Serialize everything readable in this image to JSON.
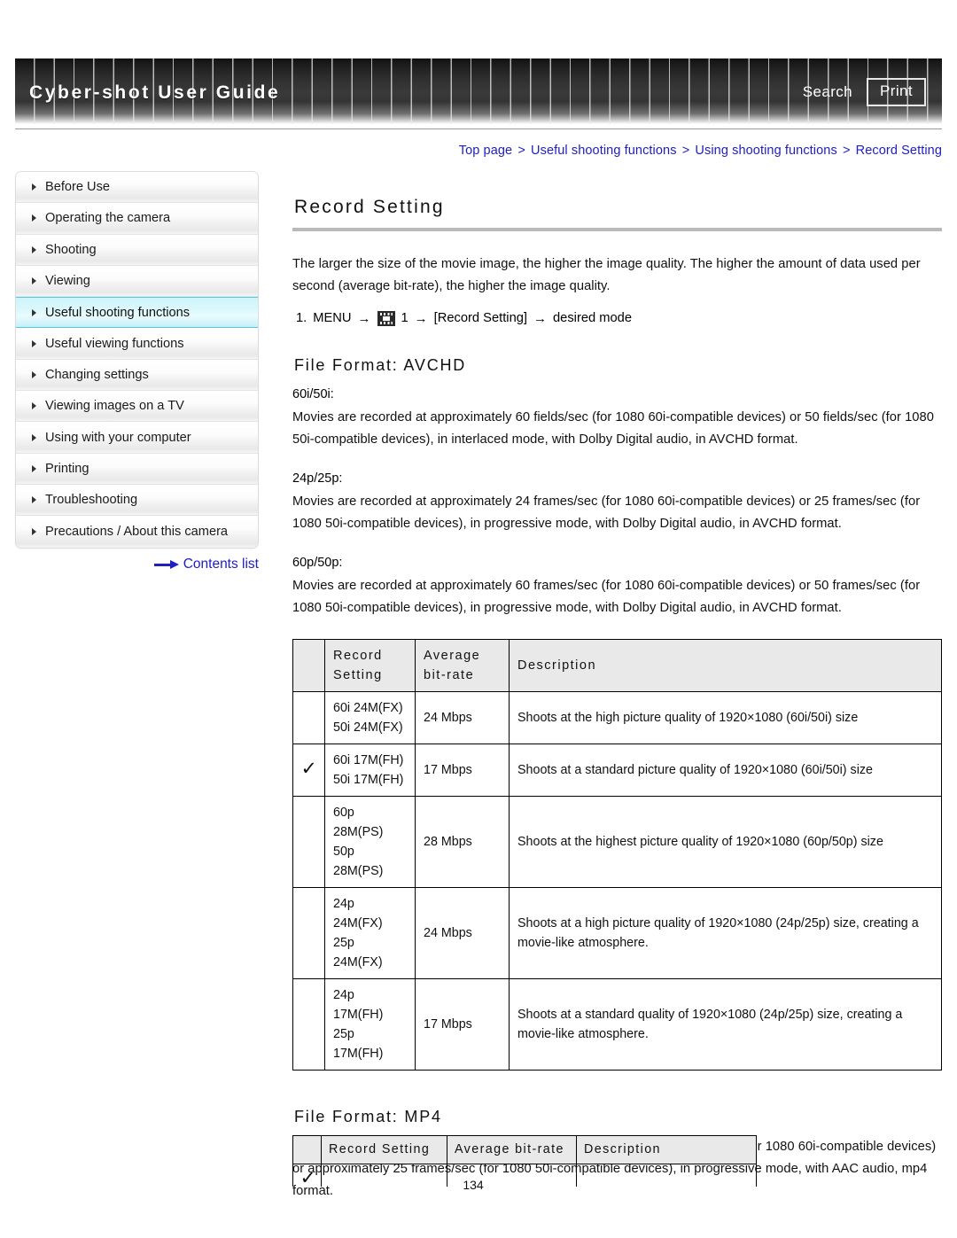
{
  "header": {
    "title": "Cyber-shot User Guide",
    "search_label": "Search",
    "print_label": "Print"
  },
  "breadcrumb": {
    "items": [
      "Top page",
      "Useful shooting functions",
      "Using shooting functions",
      "Record Setting"
    ],
    "separator": ">"
  },
  "sidebar": {
    "items": [
      {
        "label": "Before Use",
        "active": false
      },
      {
        "label": "Operating the camera",
        "active": false
      },
      {
        "label": "Shooting",
        "active": false
      },
      {
        "label": "Viewing",
        "active": false
      },
      {
        "label": "Useful shooting functions",
        "active": true
      },
      {
        "label": "Useful viewing functions",
        "active": false
      },
      {
        "label": "Changing settings",
        "active": false
      },
      {
        "label": "Viewing images on a TV",
        "active": false
      },
      {
        "label": "Using with your computer",
        "active": false
      },
      {
        "label": "Printing",
        "active": false
      },
      {
        "label": "Troubleshooting",
        "active": false
      },
      {
        "label": "Precautions / About this camera",
        "active": false
      }
    ],
    "contents_link": "Contents list"
  },
  "main": {
    "page_title": "Record Setting",
    "intro": "The larger the size of the movie image, the higher the image quality. The higher the amount of data used per second (average bit-rate), the higher the image quality.",
    "step": {
      "number": "1.",
      "menu": "MENU",
      "arrow": "→",
      "icon_suffix": "1",
      "bracket": "[Record Setting]",
      "tail": "desired mode"
    },
    "avchd": {
      "heading": "File Format: AVCHD",
      "blocks": [
        {
          "label": "60i/50i:",
          "text": "Movies are recorded at approximately 60 fields/sec (for 1080 60i-compatible devices) or 50 fields/sec (for 1080 50i-compatible devices), in interlaced mode, with Dolby Digital audio, in AVCHD format."
        },
        {
          "label": "24p/25p:",
          "text": "Movies are recorded at approximately 24 frames/sec (for 1080 60i-compatible devices) or 25 frames/sec (for 1080 50i-compatible devices), in progressive mode, with Dolby Digital audio, in AVCHD format."
        },
        {
          "label": "60p/50p:",
          "text": "Movies are recorded at approximately 60 frames/sec (for 1080 60i-compatible devices) or 50 frames/sec (for 1080 50i-compatible devices), in progressive mode, with Dolby Digital audio, in AVCHD format."
        }
      ],
      "table": {
        "headers": [
          "",
          "Record\nSetting",
          "Average\nbit-rate",
          "Description"
        ],
        "rows": [
          {
            "checked": "",
            "record_setting": "60i 24M(FX)\n50i 24M(FX)",
            "bitrate": "24 Mbps",
            "description": "Shoots at the high picture quality of 1920×1080 (60i/50i) size"
          },
          {
            "checked": "✓",
            "record_setting": "60i 17M(FH)\n50i 17M(FH)",
            "bitrate": "17 Mbps",
            "description": "Shoots at a standard picture quality of 1920×1080 (60i/50i) size"
          },
          {
            "checked": "",
            "record_setting": "60p\n28M(PS)\n50p\n28M(PS)",
            "bitrate": "28 Mbps",
            "description": "Shoots at the highest picture quality of 1920×1080 (60p/50p) size"
          },
          {
            "checked": "",
            "record_setting": "24p\n24M(FX)\n25p\n24M(FX)",
            "bitrate": "24 Mbps",
            "description": "Shoots at a high picture quality of 1920×1080 (24p/25p) size, creating a movie-like atmosphere."
          },
          {
            "checked": "",
            "record_setting": "24p\n17M(FH)\n25p\n17M(FH)",
            "bitrate": "17 Mbps",
            "description": "Shoots at a standard quality of 1920×1080 (24p/25p) size, creating a movie-like atmosphere."
          }
        ]
      }
    },
    "mp4": {
      "heading": "File Format: MP4",
      "text": "Movies shot are recorded in MPEG-4 format, at approximately 30 frames/sec (for 1080 60i-compatible devices) or approximately 25 frames/sec (for 1080 50i-compatible devices), in progressive mode, with AAC audio, mp4 format.",
      "table": {
        "headers": [
          "",
          "Record Setting",
          "Average bit-rate",
          "Description"
        ],
        "rows": [
          {
            "checked": "✓",
            "record_setting": "",
            "bitrate": "",
            "description": ""
          }
        ]
      }
    }
  },
  "footer": {
    "page_number": "134"
  },
  "colors": {
    "link": "#2020c0",
    "active_nav": "#ccf4fb",
    "table_header_bg": "#e9e9e9"
  }
}
